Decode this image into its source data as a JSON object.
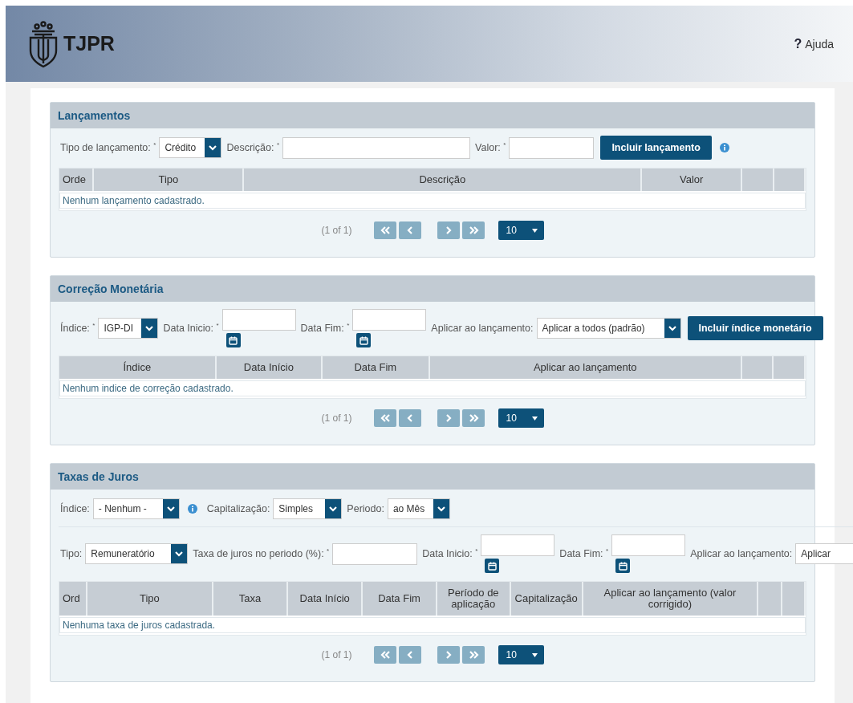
{
  "header": {
    "brand": "TJPR",
    "help": {
      "icon": "?",
      "label": "Ajuda"
    }
  },
  "sections": [
    {
      "title": "Lançamentos",
      "rows": [
        {
          "fields": [
            {
              "kind": "label",
              "text": "Tipo de lançamento: $^{*}$"
            },
            {
              "kind": "select",
              "value": "Crédito"
            },
            {
              "kind": "label",
              "text": "Descrição: $^{*}$"
            },
            {
              "kind": "input"
            },
            {
              "kind": "label",
              "text": "Valor: $^{*}$"
            },
            {
              "kind": "input"
            },
            {
              "kind": "button",
              "label": "Incluir lançamento"
            },
            {
              "kind": "info"
            }
          ]
        }
      ],
      "table": {
        "columns": [
          "Orde",
          "Tipo",
          "Descrição",
          "Valor"
        ],
        "empty": "Nenhum lançamento cadastrado."
      },
      "pager": {
        "status": "(1 of 1)",
        "page_size": "10"
      }
    },
    {
      "title": "Correção Monetária",
      "rows": [
        {
          "fields": [
            {
              "kind": "label",
              "text": "Índice: $^{*}$"
            },
            {
              "kind": "select",
              "value": "IGP-DI"
            },
            {
              "kind": "label",
              "text": "Data Inicio: $^{*}$"
            },
            {
              "kind": "date"
            },
            {
              "kind": "label",
              "text": "Data Fim: $^{*}$"
            },
            {
              "kind": "date"
            },
            {
              "kind": "label",
              "text": "Aplicar ao lançamento:"
            },
            {
              "kind": "select",
              "value": "Aplicar a todos (padrão)"
            },
            {
              "kind": "button",
              "label": "Incluir índice monetário"
            }
          ]
        }
      ],
      "table": {
        "columns": [
          "Índice",
          "Data Início",
          "Data Fim",
          "Aplicar ao lançamento"
        ],
        "empty": "Nenhum indice de correção cadastrado."
      },
      "pager": {
        "status": "(1 of 1)",
        "page_size": "10"
      }
    },
    {
      "title": "Taxas de Juros",
      "rows": [
        {
          "fields": [
            {
              "kind": "label",
              "text": "Índice:"
            },
            {
              "kind": "select",
              "value": "- Nenhum -"
            },
            {
              "kind": "info"
            },
            {
              "kind": "label",
              "text": "Capitalização:"
            },
            {
              "kind": "select",
              "value": "Simples"
            },
            {
              "kind": "label",
              "text": "Periodo:"
            },
            {
              "kind": "select",
              "value": "ao Mês"
            }
          ]
        },
        {
          "fields": [
            {
              "kind": "label",
              "text": "Tipo:"
            },
            {
              "kind": "select",
              "value": "Remuneratório"
            },
            {
              "kind": "label",
              "text": "Taxa de juros no periodo (%): $^{*}$"
            },
            {
              "kind": "input"
            },
            {
              "kind": "label",
              "text": "Data Inicio: $^{*}$"
            },
            {
              "kind": "date"
            },
            {
              "kind": "label",
              "text": "Data Fim: $^{*}$"
            },
            {
              "kind": "date"
            },
            {
              "kind": "label",
              "text": "Aplicar ao lançamento:"
            },
            {
              "kind": "cutselect",
              "value": "Aplicar"
            }
          ]
        }
      ],
      "table": {
        "columns": [
          "Ord",
          "Tipo",
          "Taxa",
          "Data Início",
          "Data Fim",
          "Período de aplicação",
          "Capitalização",
          "Aplicar ao lançamento (valor corrigido)"
        ],
        "empty": "Nenhuma taxa de juros cadastrada."
      },
      "pager": {
        "status": "(1 of 1)",
        "page_size": "10"
      }
    }
  ]
}
